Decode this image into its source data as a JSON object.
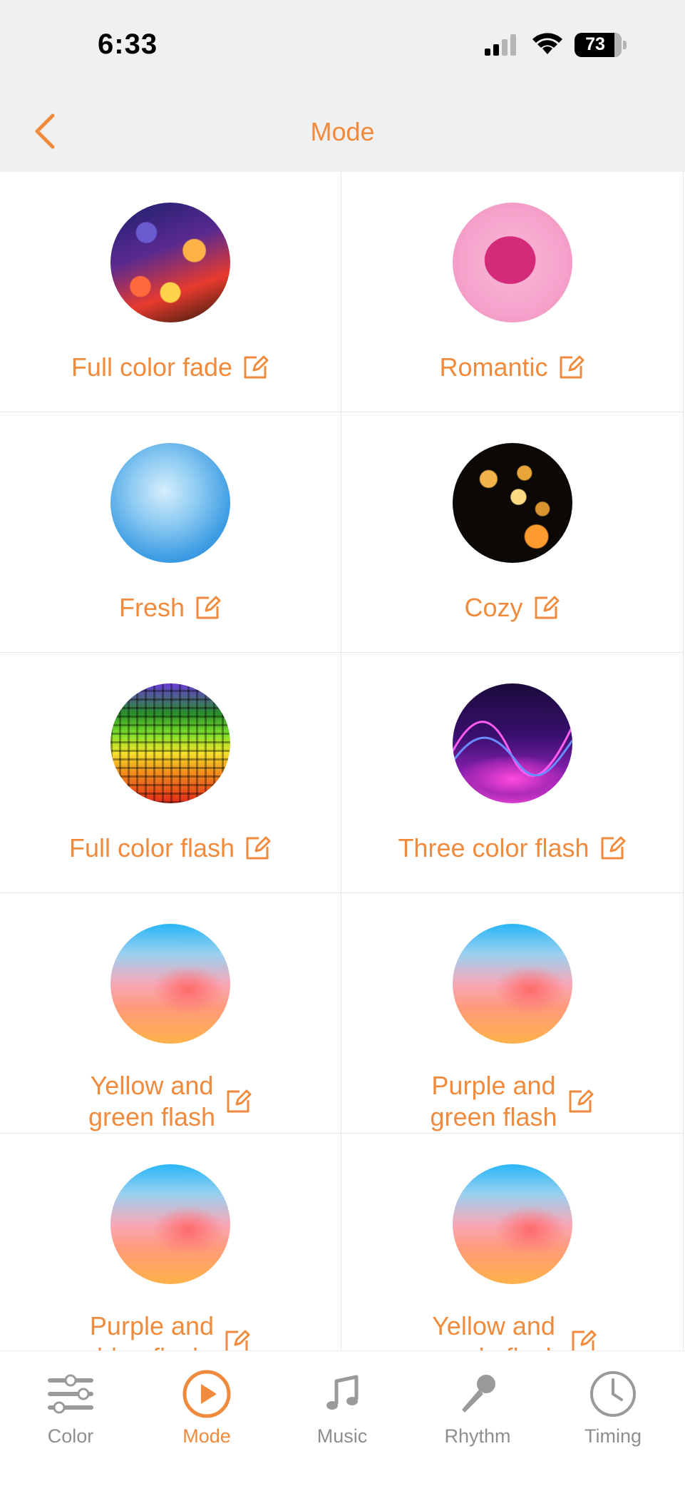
{
  "status": {
    "time": "6:33",
    "battery": "73"
  },
  "nav": {
    "title": "Mode"
  },
  "modes": [
    {
      "line1": "Full color fade",
      "line2": ""
    },
    {
      "line1": "Romantic",
      "line2": ""
    },
    {
      "line1": "Fresh",
      "line2": ""
    },
    {
      "line1": "Cozy",
      "line2": ""
    },
    {
      "line1": "Full color flash",
      "line2": ""
    },
    {
      "line1": "Three color flash",
      "line2": ""
    },
    {
      "line1": "Yellow and",
      "line2": "green flash"
    },
    {
      "line1": "Purple and",
      "line2": "green flash"
    },
    {
      "line1": "Purple and",
      "line2": "blue flash"
    },
    {
      "line1": "Yellow and",
      "line2": "purple flash"
    }
  ],
  "tabs": [
    {
      "label": "Color",
      "icon": "sliders-icon"
    },
    {
      "label": "Mode",
      "icon": "play-circle-icon"
    },
    {
      "label": "Music",
      "icon": "music-note-icon"
    },
    {
      "label": "Rhythm",
      "icon": "microphone-icon"
    },
    {
      "label": "Timing",
      "icon": "clock-icon"
    }
  ],
  "colors": {
    "accent": "#f08a3c",
    "inactive": "#8e8e8e",
    "bar": "#f0f0f0"
  }
}
